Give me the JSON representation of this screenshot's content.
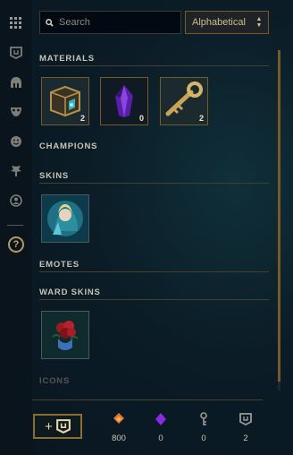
{
  "sidebar": {
    "icons": [
      "grid-icon",
      "ward-icon",
      "champion-helmet-icon",
      "mask-icon",
      "emote-face-icon",
      "tree-icon",
      "profile-icon",
      "help-icon"
    ],
    "help_label": "?"
  },
  "toolbar": {
    "search_placeholder": "Search",
    "sort_value": "Alphabetical"
  },
  "sections": {
    "materials": "MATERIALS",
    "champions": "CHAMPIONS",
    "skins": "SKINS",
    "emotes": "EMOTES",
    "ward_skins": "WARD SKINS",
    "icons": "ICONS"
  },
  "materials": [
    {
      "name": "Hextech Chest",
      "count": "2"
    },
    {
      "name": "Gemstone",
      "count": "0"
    },
    {
      "name": "Hextech Key",
      "count": "2"
    }
  ],
  "footer": {
    "craft_label": "+",
    "currencies": [
      {
        "icon": "orange-essence-icon",
        "value": "800"
      },
      {
        "icon": "gemstone-icon",
        "value": "0"
      },
      {
        "icon": "key-icon",
        "value": "0"
      },
      {
        "icon": "ward-icon",
        "value": "2"
      }
    ]
  },
  "colors": {
    "gold": "#c8aa6e",
    "purple": "#8a2be2",
    "orange": "#e07a2a"
  }
}
